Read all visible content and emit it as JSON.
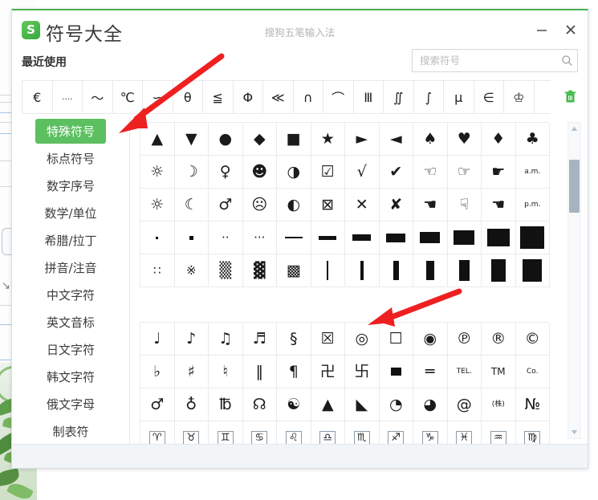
{
  "window": {
    "app_title": "符号大全",
    "subtitle": "搜狗五笔输入法",
    "logo_letter": "S",
    "accent_color": "#4cb050",
    "minimize_label": "−",
    "close_label": "✕"
  },
  "recent": {
    "label": "最近使用",
    "symbols": [
      "€",
      "‥‥",
      "～",
      "℃",
      "∽",
      "θ",
      "≦",
      "Φ",
      "≪",
      "∩",
      "⌒",
      "Ⅲ",
      "∬",
      "∫",
      "μ",
      "∈",
      "♔"
    ],
    "clear_icon": "trash-icon",
    "clear_color": "#3dbb47"
  },
  "search": {
    "placeholder": "搜索符号",
    "value": "",
    "icon": "search-icon"
  },
  "sidebar": {
    "items": [
      {
        "label": "特殊符号",
        "active": true
      },
      {
        "label": "标点符号",
        "active": false
      },
      {
        "label": "数字序号",
        "active": false
      },
      {
        "label": "数学/单位",
        "active": false
      },
      {
        "label": "希腊/拉丁",
        "active": false
      },
      {
        "label": "拼音/注音",
        "active": false
      },
      {
        "label": "中文字符",
        "active": false
      },
      {
        "label": "英文音标",
        "active": false
      },
      {
        "label": "日文字符",
        "active": false
      },
      {
        "label": "韩文字符",
        "active": false
      },
      {
        "label": "俄文字母",
        "active": false
      },
      {
        "label": "制表符",
        "active": false
      }
    ],
    "active_bg": "#5cbf60"
  },
  "symbol_grid": {
    "group1": [
      [
        "▲",
        "▼",
        "●",
        "◆",
        "■",
        "★",
        "►",
        "◄",
        "♠",
        "♥",
        "♦",
        "♣"
      ],
      [
        "☼",
        "☽",
        "♀",
        "☻",
        "◑",
        "☑",
        "√",
        "✔",
        "☜",
        "☞",
        "☛",
        "a.m."
      ],
      [
        "☼",
        "☾",
        "♂",
        "☹",
        "◐",
        "⊠",
        "✕",
        "✘",
        "☚",
        "☟",
        "☚",
        "p.m."
      ],
      [
        ".",
        "•",
        "··",
        "···",
        "▬",
        "▬",
        "▬",
        "▬",
        "▬",
        "▬",
        "▬",
        "■"
      ],
      [
        "∷",
        "※",
        "▒",
        "▓",
        "▩",
        "▏",
        "▎",
        "▍",
        "▌",
        "▋",
        "▊",
        "▉"
      ]
    ],
    "group2": [
      [
        "♩",
        "♪",
        "♫",
        "♬",
        "§",
        "☒",
        "◎",
        "☐",
        "◉",
        "℗",
        "®",
        "©"
      ],
      [
        "♭",
        "♯",
        "♮",
        "‖",
        "¶",
        "卍",
        "卐",
        "▪",
        "═",
        "TEL.",
        "TM",
        "Co."
      ],
      [
        "♂",
        "♁",
        "℔",
        "☊",
        "☯",
        "▲",
        "◣",
        "◔",
        "◕",
        "@",
        "(株)",
        "№"
      ],
      [
        "♈",
        "♉",
        "♊",
        "♋",
        "♌",
        "♎",
        "♏",
        "♐",
        "♑",
        "♓",
        "♒",
        "♍"
      ]
    ]
  },
  "scrollbar": {
    "up_icon": "triangle-up-icon",
    "down_icon": "triangle-down-icon",
    "thumb_position": "near-top"
  },
  "annotations": [
    {
      "name": "red-arrow-upper",
      "color": "#ee2020",
      "points_to": "特殊符号 category"
    },
    {
      "name": "red-arrow-lower",
      "color": "#ee2020",
      "points_to": "circle symbol ◎ in second group"
    }
  ]
}
